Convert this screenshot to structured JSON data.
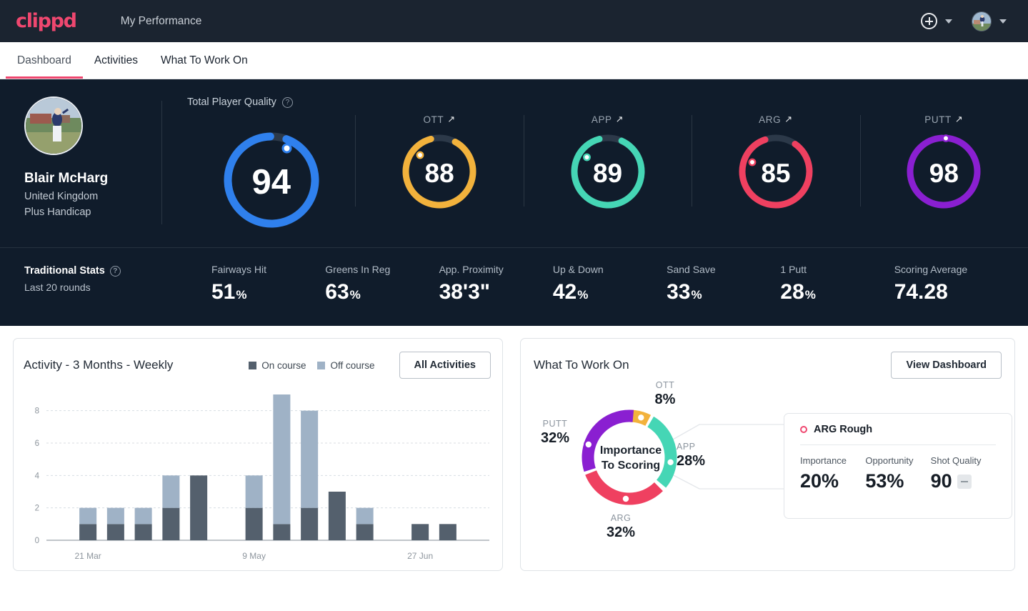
{
  "brand": {
    "logo_text": "clippd",
    "accent": "#ef476f"
  },
  "header": {
    "app_title": "My Performance",
    "add_icon": "plus-circle-icon",
    "add_caret": "chevron-down-icon",
    "avatar": "user-avatar",
    "avatar_caret": "chevron-down-icon"
  },
  "tabs": [
    {
      "label": "Dashboard",
      "active": true
    },
    {
      "label": "Activities",
      "active": false
    },
    {
      "label": "What To Work On",
      "active": false
    }
  ],
  "profile": {
    "name": "Blair McHarg",
    "country": "United Kingdom",
    "handicap": "Plus Handicap",
    "avatar": "player-photo"
  },
  "player_quality": {
    "title": "Total Player Quality",
    "help_icon": "help-circle-icon",
    "main": {
      "label": "",
      "value": "94",
      "pct": 94,
      "color": "#2f80ed"
    },
    "categories": [
      {
        "label": "OTT",
        "trend": "↗",
        "value": "88",
        "pct": 88,
        "color": "#f2b23c"
      },
      {
        "label": "APP",
        "trend": "↗",
        "value": "89",
        "pct": 89,
        "color": "#45d6b5"
      },
      {
        "label": "ARG",
        "trend": "↗",
        "value": "85",
        "pct": 85,
        "color": "#ef4060"
      },
      {
        "label": "PUTT",
        "trend": "↗",
        "value": "98",
        "pct": 98,
        "color": "#8a1fd1"
      }
    ]
  },
  "traditional_stats": {
    "title": "Traditional Stats",
    "help_icon": "help-circle-icon",
    "subtitle": "Last 20 rounds",
    "items": [
      {
        "name": "Fairways Hit",
        "value": "51",
        "unit": "%"
      },
      {
        "name": "Greens In Reg",
        "value": "63",
        "unit": "%"
      },
      {
        "name": "App. Proximity",
        "value": "38'3\"",
        "unit": ""
      },
      {
        "name": "Up & Down",
        "value": "42",
        "unit": "%"
      },
      {
        "name": "Sand Save",
        "value": "33",
        "unit": "%"
      },
      {
        "name": "1 Putt",
        "value": "28",
        "unit": "%"
      },
      {
        "name": "Scoring Average",
        "value": "74.28",
        "unit": ""
      }
    ]
  },
  "activity_card": {
    "title": "Activity - 3 Months - Weekly",
    "legend": [
      {
        "label": "On course",
        "color": "#54606d"
      },
      {
        "label": "Off course",
        "color": "#9fb2c6"
      }
    ],
    "button": "All Activities"
  },
  "work_card": {
    "title": "What To Work On",
    "button": "View Dashboard",
    "center_line1": "Importance",
    "center_line2": "To Scoring",
    "detail": {
      "marker_icon": "ring-dot-icon",
      "title": "ARG Rough",
      "columns": [
        {
          "label": "Importance",
          "value": "20%"
        },
        {
          "label": "Opportunity",
          "value": "53%"
        },
        {
          "label": "Shot Quality",
          "value": "90",
          "badge": "dash-badge"
        }
      ]
    }
  },
  "chart_data": [
    {
      "type": "bar",
      "title": "Activity - 3 Months - Weekly",
      "stacked": true,
      "xlabel": "",
      "ylabel": "",
      "ylim": [
        0,
        9
      ],
      "yticks": [
        0,
        2,
        4,
        6,
        8
      ],
      "grid": true,
      "legend_position": "top-right",
      "tick_labels": [
        "21 Mar",
        "9 May",
        "27 Jun"
      ],
      "tick_indices": [
        1,
        7,
        13
      ],
      "categories": [
        "w1",
        "w2",
        "w3",
        "w4",
        "w5",
        "w6",
        "w7",
        "w8",
        "w9",
        "w10",
        "w11",
        "w12",
        "w13",
        "w14",
        "w15",
        "w16"
      ],
      "series": [
        {
          "name": "On course",
          "color": "#54606d",
          "values": [
            0,
            1,
            1,
            1,
            2,
            4,
            0,
            2,
            1,
            2,
            3,
            1,
            0,
            1,
            1,
            0
          ]
        },
        {
          "name": "Off course",
          "color": "#9fb2c6",
          "values": [
            0,
            1,
            1,
            1,
            2,
            0,
            0,
            2,
            8,
            6,
            0,
            1,
            0,
            0,
            0,
            0
          ]
        }
      ]
    },
    {
      "type": "pie",
      "subtype": "donut",
      "title": "Importance To Scoring",
      "labels": [
        "OTT",
        "APP",
        "ARG",
        "PUTT"
      ],
      "values": [
        8,
        28,
        32,
        32
      ],
      "value_labels": [
        "8%",
        "28%",
        "32%",
        "32%"
      ],
      "colors": [
        "#f2b23c",
        "#45d6b5",
        "#ef4060",
        "#8a1fd1"
      ],
      "legend_position": "around"
    }
  ]
}
